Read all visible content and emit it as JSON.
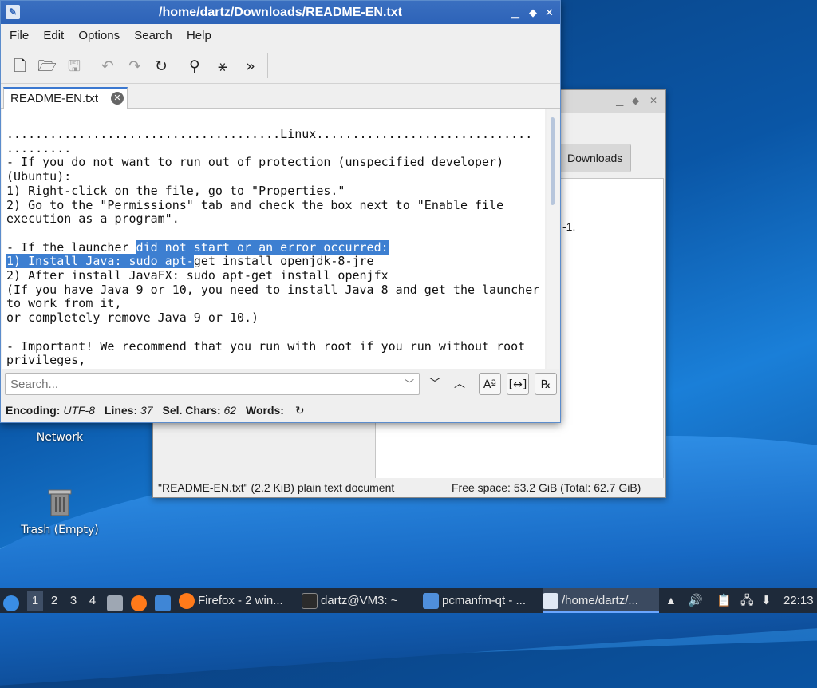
{
  "desktop": {
    "icons": [
      {
        "label": "Network"
      },
      {
        "label": "Trash (Empty)"
      }
    ]
  },
  "file_manager": {
    "breadcrumb": "Downloads",
    "partial_text": "-1.",
    "status_left": "\"README-EN.txt\" (2.2 KiB) plain text document",
    "status_right": "Free space: 53.2 GiB (Total: 62.7 GiB)"
  },
  "editor_window": {
    "title": "/home/dartz/Downloads/README-EN.txt",
    "menu": [
      "File",
      "Edit",
      "Options",
      "Search",
      "Help"
    ],
    "toolbar_icons": [
      "new-file-icon",
      "open-folder-icon",
      "save-icon",
      "undo-icon",
      "redo-icon",
      "reload-icon",
      "find-icon",
      "find-replace-icon",
      "more-icon"
    ],
    "tab_label": "README-EN.txt",
    "text": {
      "l1": "......................................Linux..............................",
      "l2": ".........",
      "l3": "- If you do not want to run out of protection (unspecified developer)",
      "l4": "(Ubuntu):",
      "l5": "1) Right-click on the file, go to \"Properties.\"",
      "l6": "2) Go to the \"Permissions\" tab and check the box next to \"Enable file",
      "l7": "execution as a program\".",
      "l8": "",
      "l9a": "- If the launcher ",
      "l9b": "did not start or an error occurred:",
      "l10a": "1) Install Java: sudo apt-",
      "l10b": "get install openjdk-8-jre",
      "l11": "2) After install JavaFX: sudo apt-get install openjfx",
      "l12": "(If you have Java 9 or 10, you need to install Java 8 and get the launcher",
      "l13": "to work from it,",
      "l14": "or completely remove Java 9 or 10.)",
      "l15": "",
      "l16": "- Important! We recommend that you run with root if you run without root",
      "l17": "privileges,"
    },
    "search_placeholder": "Search...",
    "status": {
      "encoding_label": "Encoding:",
      "encoding_value": "UTF-8",
      "lines_label": "Lines:",
      "lines_value": "37",
      "sel_label": "Sel. Chars:",
      "sel_value": "62",
      "words_label": "Words:"
    }
  },
  "taskbar": {
    "workspaces": [
      "1",
      "2",
      "3",
      "4"
    ],
    "tasks": [
      {
        "label": "Firefox - 2 win..."
      },
      {
        "label": "dartz@VM3: ~"
      },
      {
        "label": "pcmanfm-qt - ..."
      },
      {
        "label": "/home/dartz/..."
      }
    ],
    "clock": "22:13"
  }
}
